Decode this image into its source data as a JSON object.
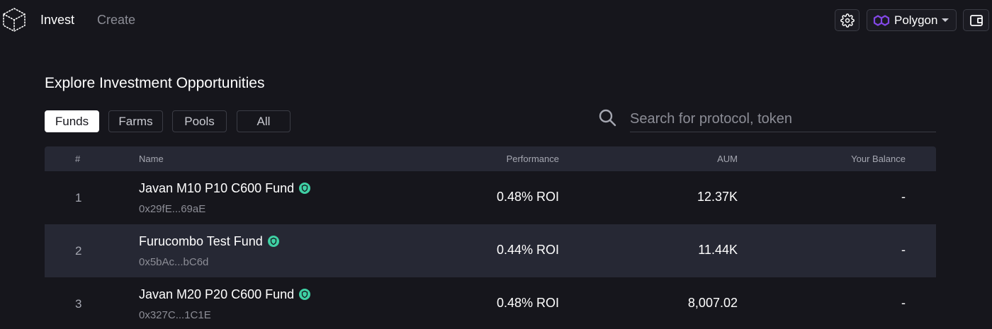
{
  "nav": {
    "links": [
      "Invest",
      "Create"
    ],
    "network": "Polygon"
  },
  "page": {
    "title": "Explore Investment Opportunities"
  },
  "filters": [
    "Funds",
    "Farms",
    "Pools",
    "All"
  ],
  "active_filter": "Funds",
  "search": {
    "placeholder": "Search for protocol, token",
    "value": ""
  },
  "table": {
    "headers": {
      "index": "#",
      "name": "Name",
      "performance": "Performance",
      "aum": "AUM",
      "balance": "Your Balance"
    },
    "rows": [
      {
        "index": "1",
        "name": "Javan M10 P10 C600 Fund",
        "address": "0x29fE...69aE",
        "performance": "0.48% ROI",
        "aum": "12.37K",
        "balance": "-",
        "verified": true
      },
      {
        "index": "2",
        "name": "Furucombo Test Fund",
        "address": "0x5bAc...bC6d",
        "performance": "0.44% ROI",
        "aum": "11.44K",
        "balance": "-",
        "verified": true
      },
      {
        "index": "3",
        "name": "Javan M20 P20 C600 Fund",
        "address": "0x327C...1C1E",
        "performance": "0.48% ROI",
        "aum": "8,007.02",
        "balance": "-",
        "verified": true
      }
    ]
  },
  "icons": {
    "logo": "cube-logo-icon",
    "settings": "gear-icon",
    "network": "polygon-icon",
    "wallet": "wallet-icon",
    "search": "search-icon",
    "verified": "shield-check-icon"
  },
  "colors": {
    "background": "#16161c",
    "row_alt": "#262834",
    "accent_verified": "#3fd0a4",
    "polygon": "#8247e5",
    "muted_text": "#8c8d96"
  }
}
